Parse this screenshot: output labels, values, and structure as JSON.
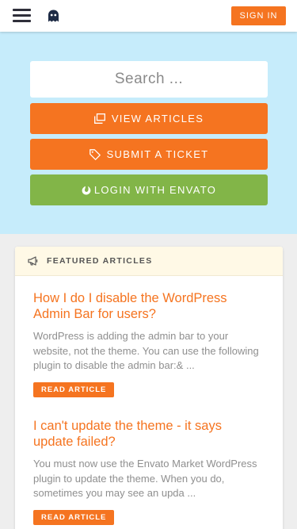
{
  "header": {
    "menu_icon": "hamburger-menu-icon",
    "logo_icon": "ghost-logo-icon",
    "signin_label": "SIGN IN"
  },
  "hero": {
    "search_placeholder": "Search ...",
    "view_articles": {
      "label": "VIEW ARTICLES",
      "icon": "copy-icon"
    },
    "submit_ticket": {
      "label": "SUBMIT A TICKET",
      "icon": "tag-icon"
    },
    "login_envato": {
      "label": "LOGIN WITH ENVATO",
      "icon": "envato-leaf-icon"
    }
  },
  "featured": {
    "title": "FEATURED ARTICLES",
    "icon": "megaphone-icon",
    "articles": [
      {
        "title": "How I do I disable the WordPress Admin Bar for users?",
        "excerpt": "WordPress is adding the admin bar to your website, not the theme. You can use the following plugin to disable the admin bar:& ...",
        "button": "READ ARTICLE"
      },
      {
        "title": "I can't update the theme - it says update failed?",
        "excerpt": "You must now use the Envato Market WordPress plugin to update the theme. When you do, sometimes you may see an upda ...",
        "button": "READ ARTICLE"
      }
    ]
  },
  "colors": {
    "accent": "#f57420",
    "envato_green": "#82b548",
    "hero_bg": "#c6ecfb"
  }
}
